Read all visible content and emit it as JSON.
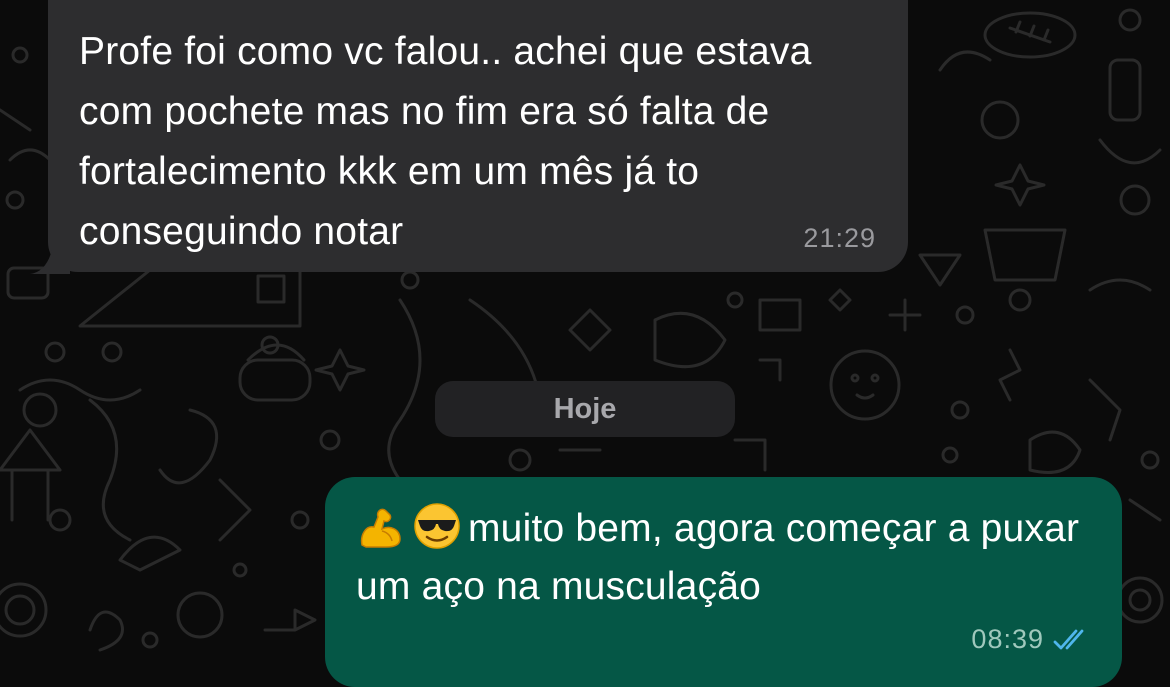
{
  "chat": {
    "incoming_message": {
      "text": "Profe foi como vc falou.. achei que estava com pochete mas no fim era só falta de fortalecimento kkk em um mês já to conseguindo notar",
      "time": "21:29"
    },
    "date_separator": "Hoje",
    "outgoing_message": {
      "emojis": [
        "flexed-biceps-emoji",
        "sunglasses-face-emoji"
      ],
      "text": "muito bem, agora começar a puxar um aço na musculação",
      "time": "08:39",
      "status_icon": "double-check-read-icon"
    }
  },
  "colors": {
    "background": "#0b0b0b",
    "incoming_bubble": "#2d2d2f",
    "outgoing_bubble": "#055746",
    "read_ticks": "#4fb6ec"
  }
}
